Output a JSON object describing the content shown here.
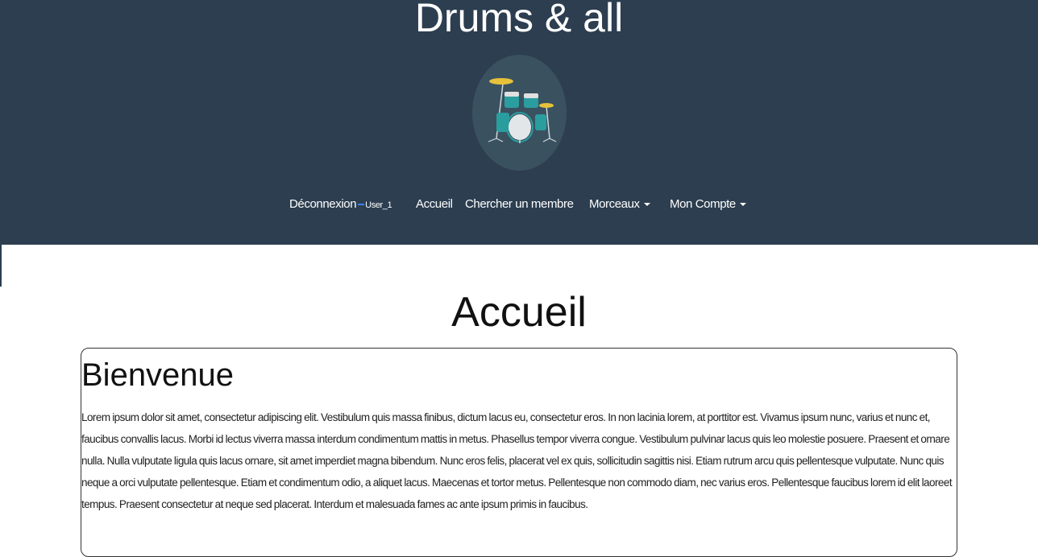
{
  "header": {
    "site_title": "Drums & all",
    "logo": "drum-kit-icon",
    "colors": {
      "background": "#2c3e50",
      "logo_circle": "#3a5160",
      "accent": "#2a9d9f",
      "cymbal": "#e6c23a"
    }
  },
  "nav": {
    "logout_label": "Déconnexion",
    "username": "User_1",
    "home_label": "Accueil",
    "search_member_label": "Chercher un membre",
    "tracks_label": "Morceaux",
    "account_label": "Mon Compte"
  },
  "main": {
    "page_title": "Accueil",
    "card": {
      "title": "Bienvenue",
      "text": "Lorem ipsum dolor sit amet, consectetur adipiscing elit. Vestibulum quis massa finibus, dictum lacus eu, consectetur eros. In non lacinia lorem, at porttitor est. Vivamus ipsum nunc, varius et nunc et, faucibus convallis lacus. Morbi id lectus viverra massa interdum condimentum mattis in metus. Phasellus tempor viverra congue. Vestibulum pulvinar lacus quis leo molestie posuere. Praesent et ornare nulla. Nulla vulputate ligula quis lacus ornare, sit amet imperdiet magna bibendum. Nunc eros felis, placerat vel ex quis, sollicitudin sagittis nisi. Etiam rutrum arcu quis pellentesque vulputate. Nunc quis neque a orci vulputate pellentesque. Etiam et condimentum odio, a aliquet lacus. Maecenas et tortor metus. Pellentesque non commodo diam, nec varius eros. Pellentesque faucibus lorem id elit laoreet tempus. Praesent consectetur at neque sed placerat. Interdum et malesuada fames ac ante ipsum primis in faucibus."
    }
  }
}
